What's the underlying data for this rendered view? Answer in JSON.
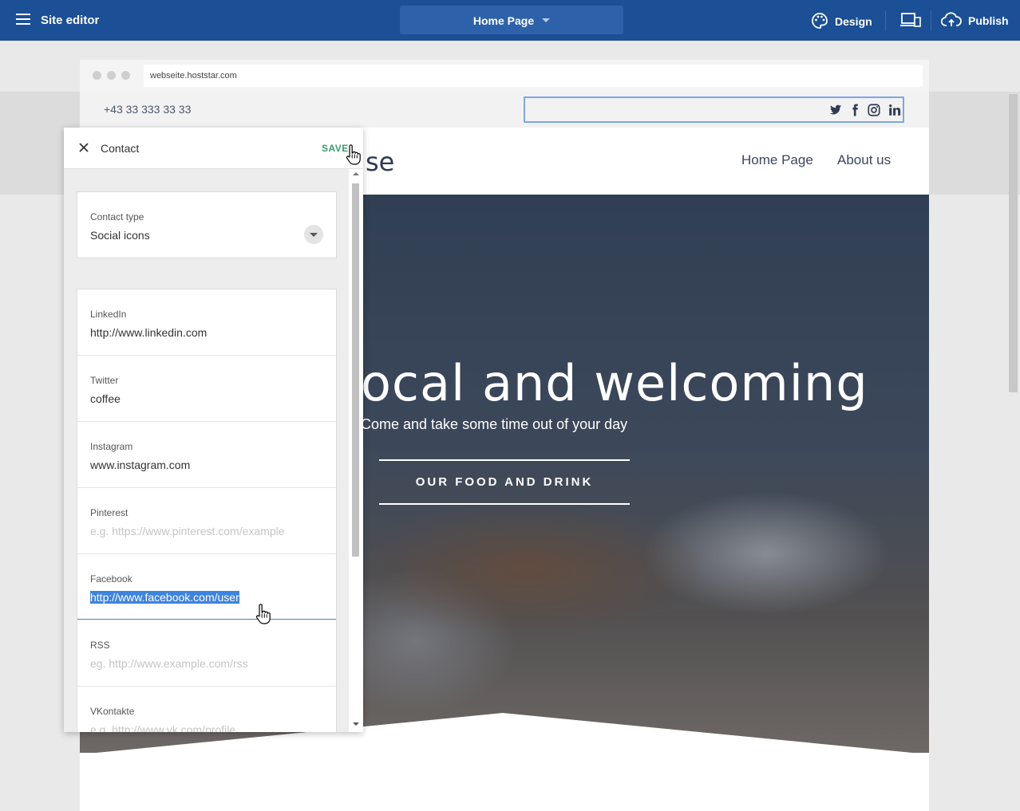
{
  "topbar": {
    "title": "Site editor",
    "page_select": "Home Page",
    "design_label": "Design",
    "publish_label": "Publish"
  },
  "browser": {
    "url": "webseite.hoststar.com"
  },
  "site": {
    "phone": "+43 33 333 33 33",
    "logo_fragment": "se",
    "nav": [
      "Home Page",
      "About us"
    ],
    "hero_title": "ocal and welcoming",
    "hero_subtitle": "Come and take some time out of your day",
    "hero_button": "OUR FOOD AND DRINK",
    "social_icons": [
      "twitter-icon",
      "facebook-icon",
      "instagram-icon",
      "linkedin-icon"
    ]
  },
  "panel": {
    "title": "Contact",
    "save_label": "SAVE",
    "contact_type": {
      "label": "Contact type",
      "value": "Social icons"
    },
    "fields": [
      {
        "label": "LinkedIn",
        "value": "http://www.linkedin.com",
        "placeholder": ""
      },
      {
        "label": "Twitter",
        "value": "coffee",
        "placeholder": ""
      },
      {
        "label": "Instagram",
        "value": "www.instagram.com",
        "placeholder": ""
      },
      {
        "label": "Pinterest",
        "value": "",
        "placeholder": "e.g. https://www.pinterest.com/example"
      },
      {
        "label": "Facebook",
        "value": "http://www.facebook.com/user",
        "placeholder": ""
      },
      {
        "label": "RSS",
        "value": "",
        "placeholder": "eg. http://www.example.com/rss"
      },
      {
        "label": "VKontakte",
        "value": "",
        "placeholder": "e.g. http://www.vk.com/profile"
      }
    ]
  },
  "colors": {
    "topbar": "#1b4f96",
    "accent_save": "#3a9a73",
    "selection": "#3d83e0"
  }
}
